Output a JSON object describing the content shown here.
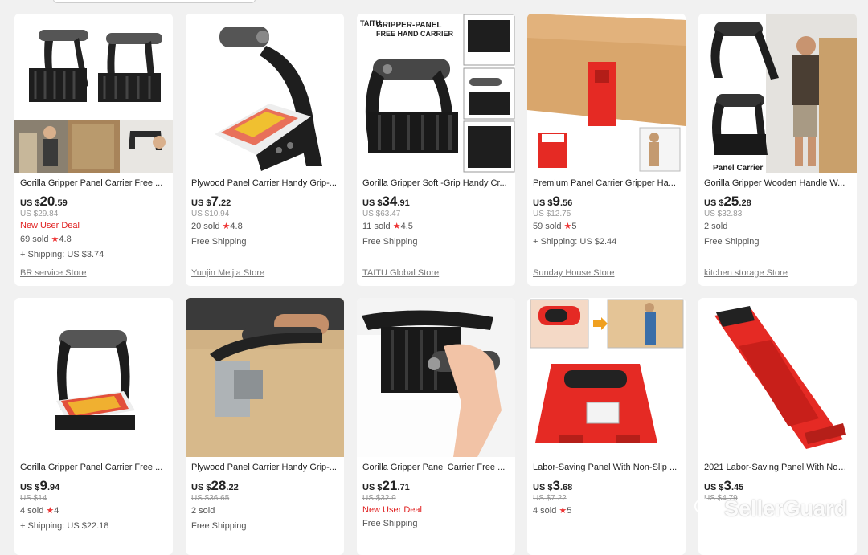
{
  "products": [
    {
      "title": "Gorilla Gripper Panel Carrier Free ...",
      "price_currency": "US $",
      "price_whole": "20",
      "price_frac": ".59",
      "original_price": "US $29.84",
      "deal": "New User Deal",
      "sold": "69 sold",
      "rating": "4.8",
      "shipping": "+ Shipping: US $3.74",
      "store": "BR service Store"
    },
    {
      "title": "Plywood Panel Carrier Handy Grip-...",
      "price_currency": "US $",
      "price_whole": "7",
      "price_frac": ".22",
      "original_price": "US $10.94",
      "deal": "",
      "sold": "20 sold",
      "rating": "4.8",
      "shipping": "Free Shipping",
      "store": "Yunjin Meijia Store"
    },
    {
      "title": "Gorilla Gripper Soft -Grip Handy Cr...",
      "price_currency": "US $",
      "price_whole": "34",
      "price_frac": ".91",
      "original_price": "US $63.47",
      "deal": "",
      "sold": "11 sold",
      "rating": "4.5",
      "shipping": "Free Shipping",
      "store": "TAITU Global Store",
      "image_text": [
        "TAITU",
        "GRIPPER-PANEL",
        "FREE HAND CARRIER"
      ]
    },
    {
      "title": "Premium Panel Carrier Gripper Ha...",
      "price_currency": "US $",
      "price_whole": "9",
      "price_frac": ".56",
      "original_price": "US $12.75",
      "deal": "",
      "sold": "59 sold",
      "rating": "5",
      "shipping": "+ Shipping: US $2.44",
      "store": "Sunday House Store"
    },
    {
      "title": "Gorilla Gripper Wooden Handle W...",
      "price_currency": "US $",
      "price_whole": "25",
      "price_frac": ".28",
      "original_price": "US $32.83",
      "deal": "",
      "sold": "2 sold",
      "rating": "",
      "shipping": "Free Shipping",
      "store": "kitchen storage Store",
      "image_text": [
        "Panel Carrier"
      ]
    },
    {
      "title": "Gorilla Gripper Panel Carrier Free ...",
      "price_currency": "US $",
      "price_whole": "9",
      "price_frac": ".94",
      "original_price": "US $14",
      "deal": "",
      "sold": "4 sold",
      "rating": "4",
      "shipping": "+ Shipping: US $22.18",
      "store": ""
    },
    {
      "title": "Plywood Panel Carrier Handy Grip-...",
      "price_currency": "US $",
      "price_whole": "28",
      "price_frac": ".22",
      "original_price": "US $36.65",
      "deal": "",
      "sold": "2 sold",
      "rating": "",
      "shipping": "Free Shipping",
      "store": ""
    },
    {
      "title": "Gorilla Gripper Panel Carrier Free ...",
      "price_currency": "US $",
      "price_whole": "21",
      "price_frac": ".71",
      "original_price": "US $32.9",
      "deal": "New User Deal",
      "sold": "",
      "rating": "",
      "shipping": "Free Shipping",
      "store": ""
    },
    {
      "title": "Labor-Saving Panel With Non-Slip ...",
      "price_currency": "US $",
      "price_whole": "3",
      "price_frac": ".68",
      "original_price": "US $7.22",
      "deal": "",
      "sold": "4 sold",
      "rating": "5",
      "shipping": "",
      "store": ""
    },
    {
      "title": "2021 Labor-Saving Panel With Non-...",
      "price_currency": "US $",
      "price_whole": "3",
      "price_frac": ".45",
      "original_price": "US $4.79",
      "deal": "",
      "sold": "",
      "rating": "",
      "shipping": "",
      "store": ""
    }
  ],
  "watermark": {
    "text": "SellerGuard",
    "icon": "wechat-icon"
  },
  "colors": {
    "deal": "#e02020",
    "star": "#e33333",
    "handle_black": "#2a2a2a",
    "carrier_red": "#e52a24"
  }
}
